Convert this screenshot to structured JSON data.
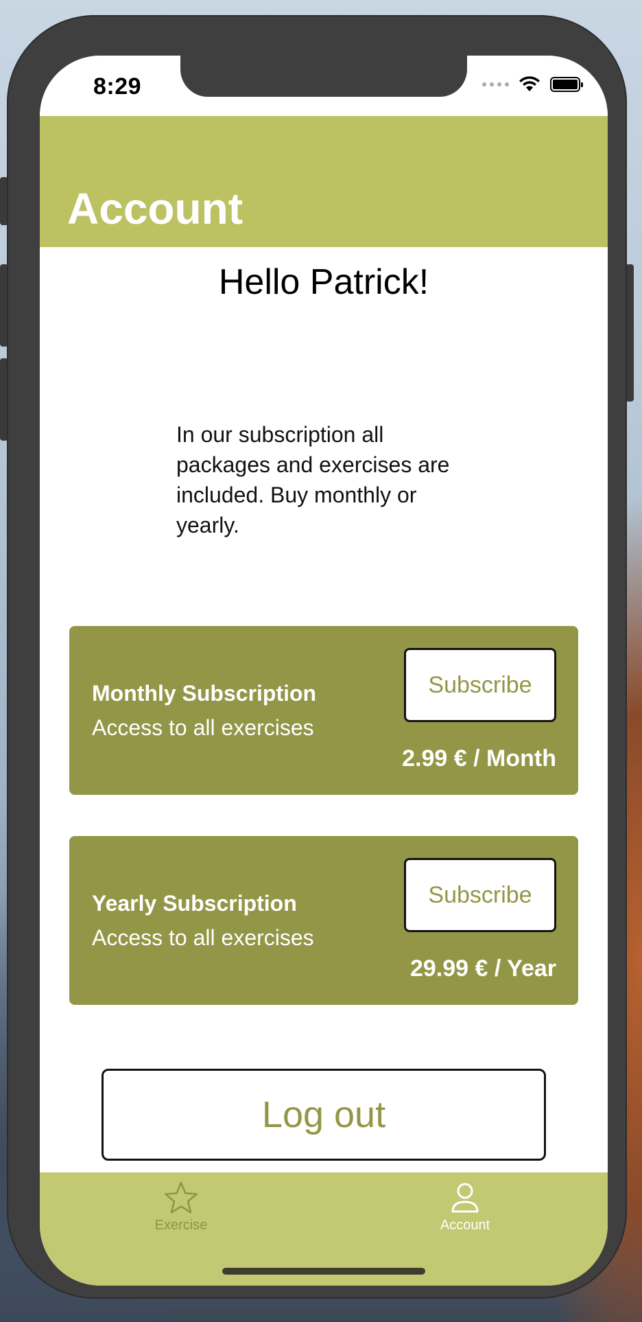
{
  "status_bar": {
    "time": "8:29"
  },
  "nav": {
    "title": "Account"
  },
  "greeting": "Hello Patrick!",
  "intro_text": "In our subscription all packages and exercises are included. Buy monthly or yearly.",
  "subscriptions": [
    {
      "title": "Monthly Subscription",
      "subtitle": "Access to all exercises",
      "button_label": "Subscribe",
      "price": "2.99 € / Month"
    },
    {
      "title": "Yearly Subscription",
      "subtitle": "Access to all exercises",
      "button_label": "Subscribe",
      "price": "29.99 € / Year"
    }
  ],
  "logout_label": "Log out",
  "tabs": [
    {
      "label": "Exercise",
      "icon": "star-icon",
      "active": false
    },
    {
      "label": "Account",
      "icon": "person-icon",
      "active": true
    }
  ],
  "colors": {
    "header": "#bcc162",
    "card": "#939646",
    "tab_bar": "#c3c873",
    "accent_text": "#939646"
  }
}
